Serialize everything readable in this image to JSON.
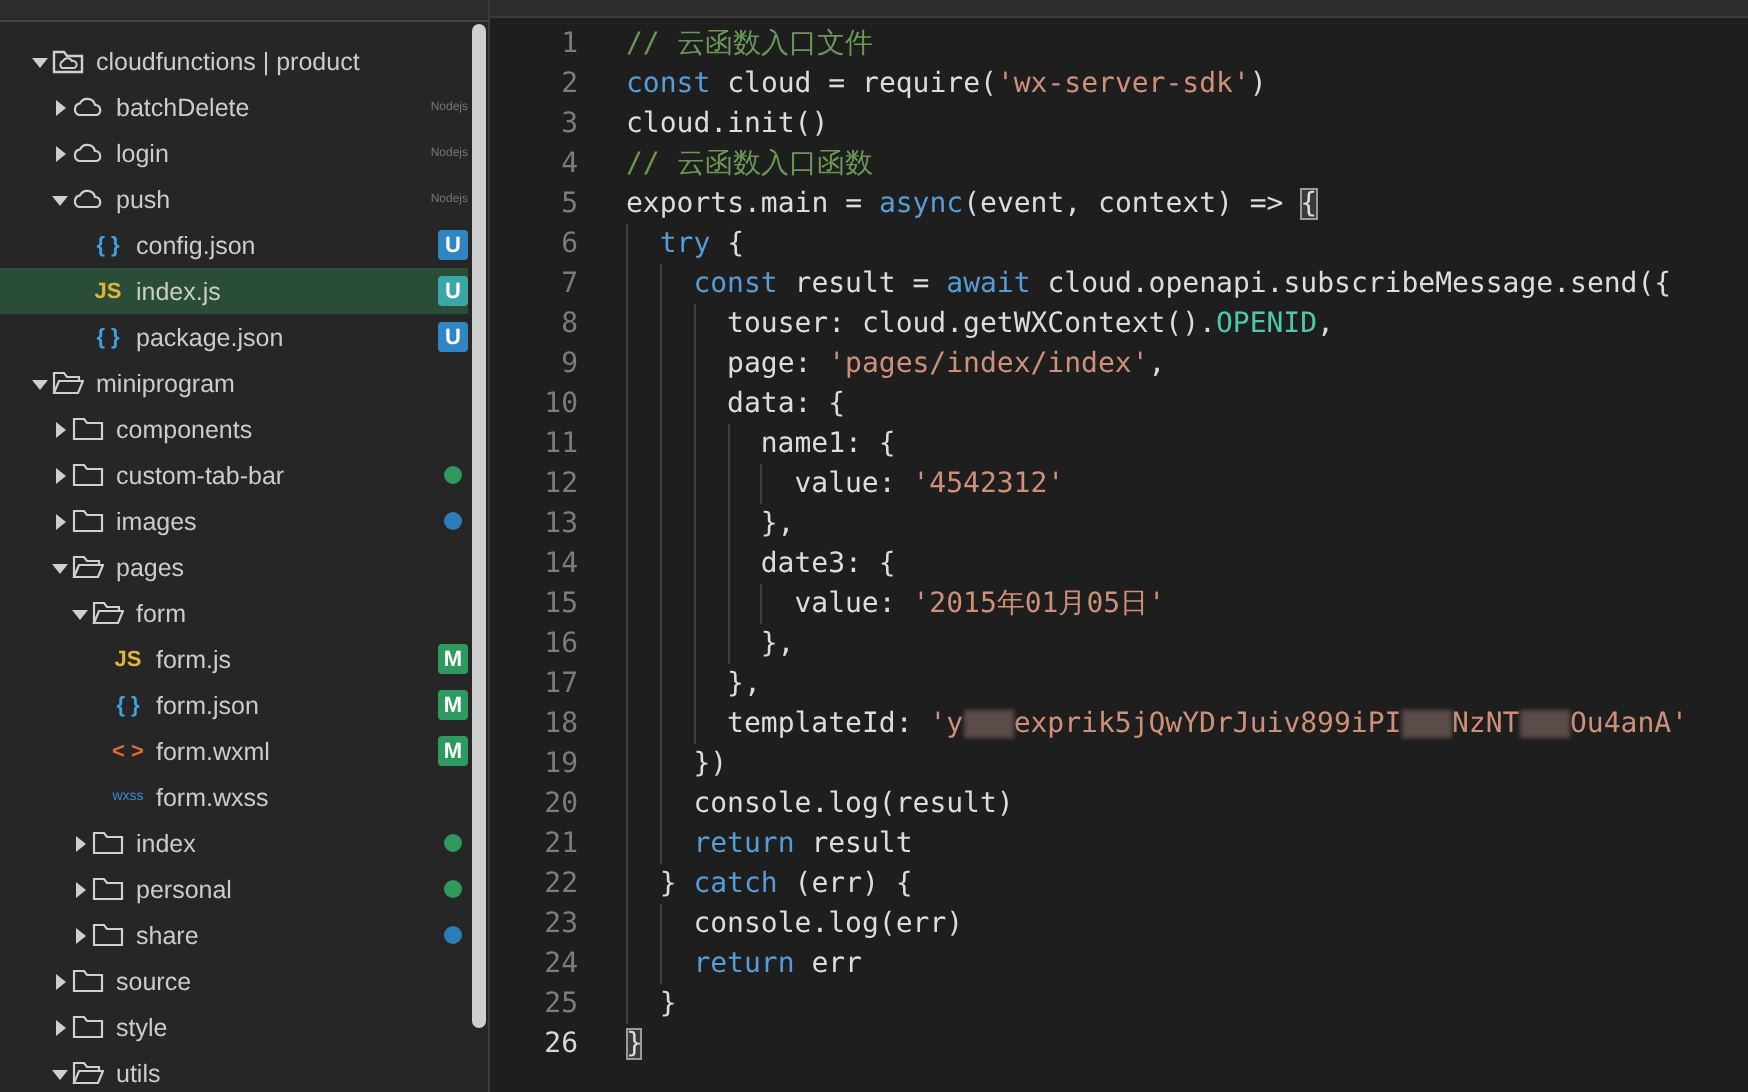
{
  "explorer": {
    "tree": [
      {
        "label": "cloudfunctions | product",
        "kind": "cloud-folder",
        "expanded": true,
        "selected": false,
        "children": [
          {
            "label": "batchDelete",
            "kind": "cloud",
            "expanded": false,
            "selected": false,
            "tag": "Nodejs"
          },
          {
            "label": "login",
            "kind": "cloud",
            "expanded": false,
            "selected": false,
            "tag": "Nodejs"
          },
          {
            "label": "push",
            "kind": "cloud",
            "expanded": true,
            "selected": false,
            "tag": "Nodejs",
            "children": [
              {
                "label": "config.json",
                "kind": "json",
                "icon_label": "{ }",
                "badge": "U",
                "selected": false
              },
              {
                "label": "index.js",
                "kind": "js",
                "icon_label": "JS",
                "badge": "U",
                "selected": true
              },
              {
                "label": "package.json",
                "kind": "json",
                "icon_label": "{ }",
                "badge": "U",
                "selected": false
              }
            ]
          }
        ]
      },
      {
        "label": "miniprogram",
        "kind": "folder",
        "expanded": true,
        "selected": false,
        "children": [
          {
            "label": "components",
            "kind": "folder",
            "expanded": false,
            "selected": false
          },
          {
            "label": "custom-tab-bar",
            "kind": "folder",
            "expanded": false,
            "selected": false,
            "color": "#2e9a5e"
          },
          {
            "label": "images",
            "kind": "folder",
            "expanded": false,
            "selected": false,
            "color": "#2b7cb8"
          },
          {
            "label": "pages",
            "kind": "folder",
            "expanded": true,
            "selected": false,
            "children": [
              {
                "label": "form",
                "kind": "folder",
                "expanded": true,
                "selected": false,
                "children": [
                  {
                    "label": "form.js",
                    "kind": "js",
                    "icon_label": "JS",
                    "badge": "M",
                    "selected": false
                  },
                  {
                    "label": "form.json",
                    "kind": "json",
                    "icon_label": "{ }",
                    "badge": "M",
                    "selected": false
                  },
                  {
                    "label": "form.wxml",
                    "kind": "wxml",
                    "icon_label": "< >",
                    "badge": "M",
                    "selected": false
                  },
                  {
                    "label": "form.wxss",
                    "kind": "wxss",
                    "icon_label": "wxss",
                    "selected": false
                  }
                ]
              },
              {
                "label": "index",
                "kind": "folder",
                "expanded": false,
                "selected": false,
                "color": "#2e9a5e"
              },
              {
                "label": "personal",
                "kind": "folder",
                "expanded": false,
                "selected": false,
                "color": "#2e9a5e"
              },
              {
                "label": "share",
                "kind": "folder",
                "expanded": false,
                "selected": false,
                "color": "#2b7cb8"
              }
            ]
          },
          {
            "label": "source",
            "kind": "folder",
            "expanded": false,
            "selected": false
          },
          {
            "label": "style",
            "kind": "folder",
            "expanded": false,
            "selected": false
          },
          {
            "label": "utils",
            "kind": "folder",
            "expanded": true,
            "selected": false
          }
        ]
      }
    ]
  },
  "editor": {
    "lines": [
      {
        "number": "1",
        "current": false,
        "tokens": [
          {
            "kind": "comment",
            "text": "// 云函数入口文件"
          }
        ]
      },
      {
        "number": "2",
        "current": false,
        "tokens": [
          {
            "kind": "keyword",
            "text": "const"
          },
          {
            "kind": "plain",
            "text": " cloud = require("
          },
          {
            "kind": "string",
            "text": "'wx-server-sdk'"
          },
          {
            "kind": "plain",
            "text": ")"
          }
        ]
      },
      {
        "number": "3",
        "current": false,
        "tokens": [
          {
            "kind": "plain",
            "text": "cloud.init()"
          }
        ]
      },
      {
        "number": "4",
        "current": false,
        "tokens": [
          {
            "kind": "comment",
            "text": "// 云函数入口函数"
          }
        ]
      },
      {
        "number": "5",
        "current": false,
        "tokens": [
          {
            "kind": "plain",
            "text": "exports.main = "
          },
          {
            "kind": "keyword",
            "text": "async"
          },
          {
            "kind": "plain",
            "text": "(event, context) => "
          },
          {
            "kind": "match",
            "text": "{"
          }
        ]
      },
      {
        "number": "6",
        "current": false,
        "tokens": [
          {
            "kind": "keyword",
            "text": "  try"
          },
          {
            "kind": "plain",
            "text": " {"
          }
        ]
      },
      {
        "number": "7",
        "current": false,
        "tokens": [
          {
            "kind": "keyword",
            "text": "    const"
          },
          {
            "kind": "plain",
            "text": " result = "
          },
          {
            "kind": "keyword",
            "text": "await"
          },
          {
            "kind": "plain",
            "text": " cloud.openapi.subscribeMessage.send({"
          }
        ]
      },
      {
        "number": "8",
        "current": false,
        "tokens": [
          {
            "kind": "plain",
            "text": "      touser: cloud.getWXContext()."
          },
          {
            "kind": "constant",
            "text": "OPENID"
          },
          {
            "kind": "plain",
            "text": ","
          }
        ]
      },
      {
        "number": "9",
        "current": false,
        "tokens": [
          {
            "kind": "plain",
            "text": "      page: "
          },
          {
            "kind": "string",
            "text": "'pages/index/index'"
          },
          {
            "kind": "plain",
            "text": ","
          }
        ]
      },
      {
        "number": "10",
        "current": false,
        "tokens": [
          {
            "kind": "plain",
            "text": "      data: {"
          }
        ]
      },
      {
        "number": "11",
        "current": false,
        "tokens": [
          {
            "kind": "plain",
            "text": "        name1: {"
          }
        ]
      },
      {
        "number": "12",
        "current": false,
        "tokens": [
          {
            "kind": "plain",
            "text": "          value: "
          },
          {
            "kind": "string",
            "text": "'4542312'"
          }
        ]
      },
      {
        "number": "13",
        "current": false,
        "tokens": [
          {
            "kind": "plain",
            "text": "        },"
          }
        ]
      },
      {
        "number": "14",
        "current": false,
        "tokens": [
          {
            "kind": "plain",
            "text": "        date3: {"
          }
        ]
      },
      {
        "number": "15",
        "current": false,
        "tokens": [
          {
            "kind": "plain",
            "text": "          value: "
          },
          {
            "kind": "string",
            "text": "'2015年01月05日'"
          }
        ]
      },
      {
        "number": "16",
        "current": false,
        "tokens": [
          {
            "kind": "plain",
            "text": "        },"
          }
        ]
      },
      {
        "number": "17",
        "current": false,
        "tokens": [
          {
            "kind": "plain",
            "text": "      },"
          }
        ]
      },
      {
        "number": "18",
        "current": false,
        "tokens": [
          {
            "kind": "plain",
            "text": "      templateId: "
          },
          {
            "kind": "string",
            "text": "'y"
          },
          {
            "kind": "redacted"
          },
          {
            "kind": "string",
            "text": "exprik5jQwYDrJuiv899iPI"
          },
          {
            "kind": "redacted"
          },
          {
            "kind": "string",
            "text": "NzNT"
          },
          {
            "kind": "redacted"
          },
          {
            "kind": "string",
            "text": "Ou4anA'"
          }
        ]
      },
      {
        "number": "19",
        "current": false,
        "tokens": [
          {
            "kind": "plain",
            "text": "    })"
          }
        ]
      },
      {
        "number": "20",
        "current": false,
        "tokens": [
          {
            "kind": "plain",
            "text": "    console.log(result)"
          }
        ]
      },
      {
        "number": "21",
        "current": false,
        "tokens": [
          {
            "kind": "keyword",
            "text": "    return"
          },
          {
            "kind": "plain",
            "text": " result"
          }
        ]
      },
      {
        "number": "22",
        "current": false,
        "tokens": [
          {
            "kind": "plain",
            "text": "  } "
          },
          {
            "kind": "keyword",
            "text": "catch"
          },
          {
            "kind": "plain",
            "text": " (err) {"
          }
        ]
      },
      {
        "number": "23",
        "current": false,
        "tokens": [
          {
            "kind": "plain",
            "text": "    console.log(err)"
          }
        ]
      },
      {
        "number": "24",
        "current": false,
        "tokens": [
          {
            "kind": "keyword",
            "text": "    return"
          },
          {
            "kind": "plain",
            "text": " err"
          }
        ]
      },
      {
        "number": "25",
        "current": false,
        "tokens": [
          {
            "kind": "plain",
            "text": "  }"
          }
        ]
      },
      {
        "number": "26",
        "current": true,
        "tokens": [
          {
            "kind": "match",
            "text": "}"
          }
        ]
      }
    ]
  }
}
